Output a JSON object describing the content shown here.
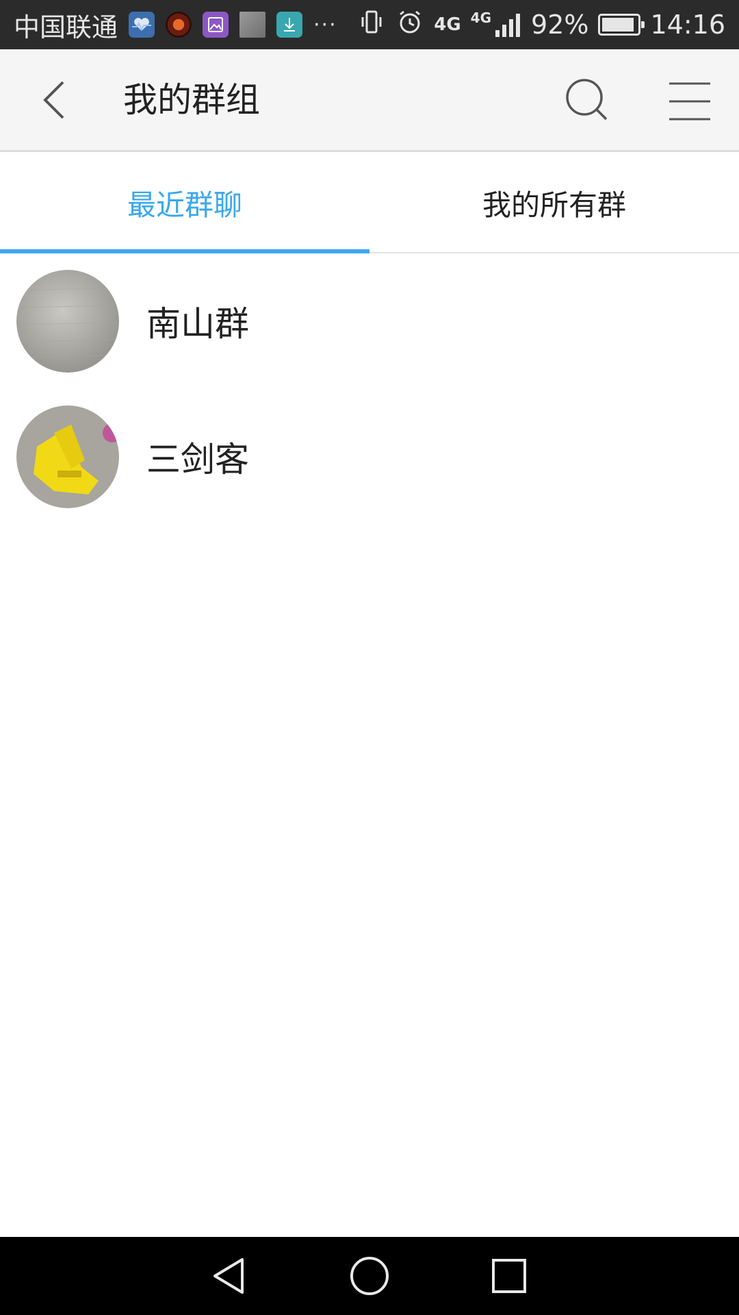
{
  "status_bar": {
    "carrier": "中国联通",
    "more_indicator": "···",
    "network_primary": "4G",
    "network_secondary": "4G",
    "battery_percent": "92%",
    "battery_level": 0.92,
    "time": "14:16",
    "notification_icons": [
      "health-icon",
      "orb-app-icon",
      "gallery-icon",
      "image-thumbnail-icon",
      "download-icon"
    ],
    "system_icons": [
      "vibrate-icon",
      "alarm-icon",
      "signal-icon",
      "battery-icon"
    ]
  },
  "app_bar": {
    "title": "我的群组",
    "icons": [
      "back-arrow-icon",
      "search-icon",
      "menu-icon"
    ]
  },
  "tabs": [
    {
      "label": "最近群聊",
      "active": true
    },
    {
      "label": "我的所有群",
      "active": false
    }
  ],
  "groups": [
    {
      "name": "南山群",
      "avatar": "gray-texture-avatar"
    },
    {
      "name": "三剑客",
      "avatar": "yellow-stand-avatar"
    }
  ],
  "colors": {
    "accent": "#3aa8ec",
    "app_bar_bg": "#f5f5f5",
    "status_bar_bg": "#2b2b2b",
    "nav_bar_bg": "#000000"
  },
  "nav_bar": {
    "icons": [
      "nav-back-icon",
      "nav-home-icon",
      "nav-recents-icon"
    ]
  }
}
